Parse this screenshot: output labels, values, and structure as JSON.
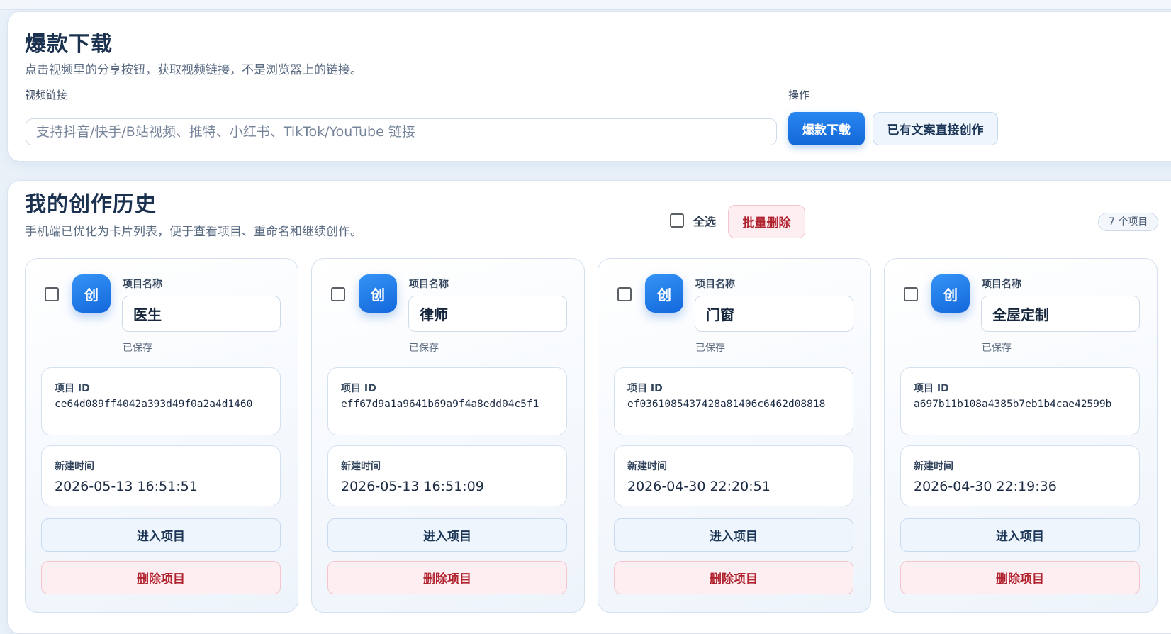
{
  "download": {
    "title": "爆款下载",
    "subtitle": "点击视频里的分享按钮，获取视频链接，不是浏览器上的链接。",
    "link_label": "视频链接",
    "link_placeholder": "支持抖音/快手/B站视频、推特、小红书、TikTok/YouTube 链接",
    "link_value": "",
    "action_label": "操作",
    "download_button": "爆款下载",
    "direct_create_button": "已有文案直接创作"
  },
  "history": {
    "title": "我的创作历史",
    "subtitle": "手机端已优化为卡片列表，便于查看项目、重命名和继续创作。",
    "select_all_label": "全选",
    "batch_delete_button": "批量删除",
    "count_badge": "7 个项目",
    "card_labels": {
      "avatar_text": "创",
      "name_label": "项目名称",
      "saved_status": "已保存",
      "id_label": "项目 ID",
      "time_label": "新建时间",
      "enter_button": "进入项目",
      "delete_button": "删除项目"
    },
    "projects": [
      {
        "name": "医生",
        "id": "ce64d089ff4042a393d49f0a2a4d1460",
        "created": "2026-05-13 16:51:51"
      },
      {
        "name": "律师",
        "id": "eff67d9a1a9641b69a9f4a8edd04c5f1",
        "created": "2026-05-13 16:51:09"
      },
      {
        "name": "门窗",
        "id": "ef0361085437428a81406c6462d08818",
        "created": "2026-04-30 22:20:51"
      },
      {
        "name": "全屋定制",
        "id": "a697b11b108a4385b7eb1b4cae42599b",
        "created": "2026-04-30 22:19:36"
      }
    ]
  },
  "colors": {
    "primary": "#1a73e8",
    "danger": "#b1222f",
    "heading": "#1a3150"
  }
}
